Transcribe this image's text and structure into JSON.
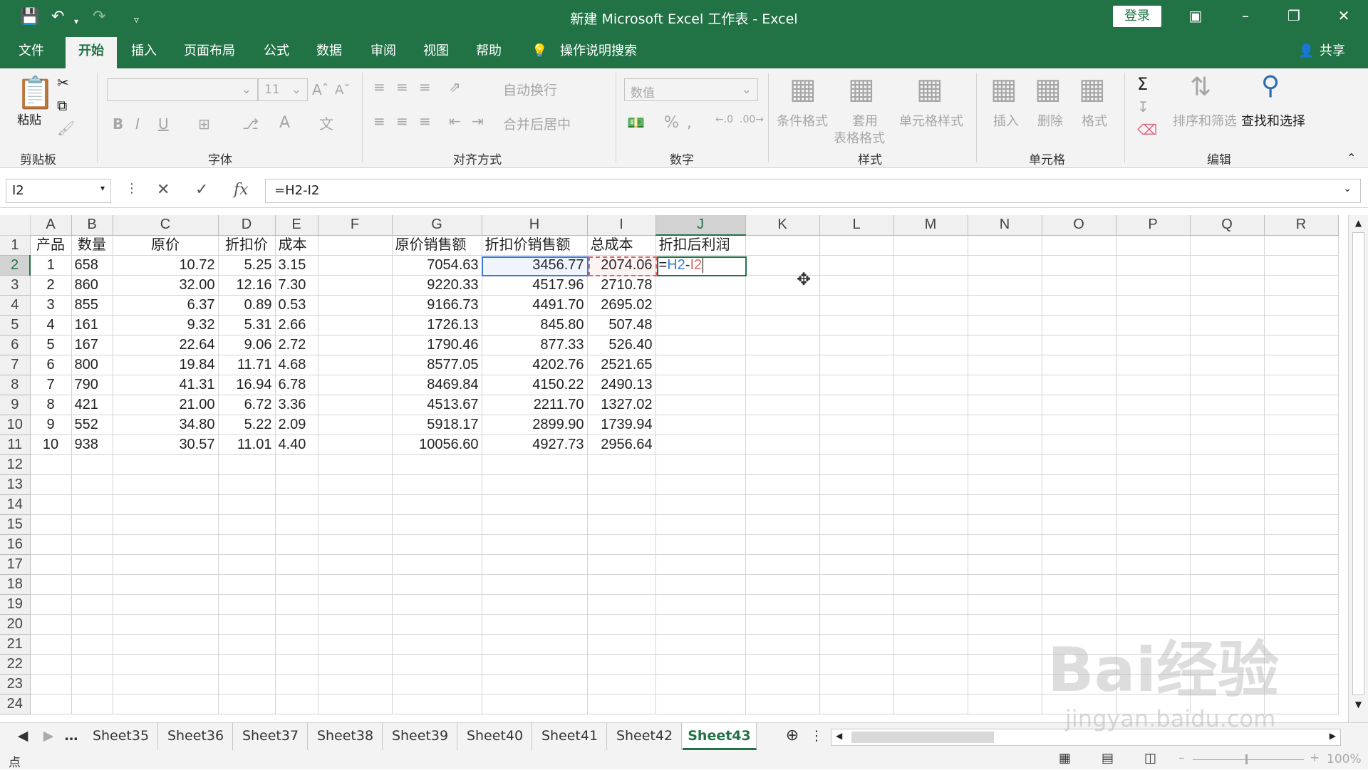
{
  "window": {
    "title": "新建 Microsoft Excel 工作表  -  Excel",
    "login": "登录"
  },
  "tabs": [
    "文件",
    "开始",
    "插入",
    "页面布局",
    "公式",
    "数据",
    "审阅",
    "视图",
    "帮助"
  ],
  "tell_me": "操作说明搜索",
  "share": "共享",
  "ribbon": {
    "clipboard": {
      "paste": "粘贴",
      "label": "剪贴板"
    },
    "font": {
      "label": "字体",
      "size": "11"
    },
    "alignment": {
      "wrap": "自动换行",
      "merge": "合并后居中",
      "label": "对齐方式"
    },
    "number": {
      "format": "数值",
      "label": "数字"
    },
    "styles": {
      "cond": "条件格式",
      "table1": "套用",
      "table2": "表格格式",
      "cell": "单元格样式",
      "label": "样式"
    },
    "cells": {
      "insert": "插入",
      "delete": "删除",
      "format": "格式",
      "label": "单元格"
    },
    "editing": {
      "sort": "排序和筛选",
      "find": "查找和选择",
      "label": "编辑"
    }
  },
  "formula_bar": {
    "name_box": "I2",
    "formula": "=H2-I2"
  },
  "columns": [
    "A",
    "B",
    "C",
    "D",
    "E",
    "F",
    "G",
    "H",
    "I",
    "J",
    "K",
    "L",
    "M",
    "N",
    "O",
    "P",
    "Q",
    "R"
  ],
  "headers": [
    "产品",
    "数量",
    "原价",
    "折扣价",
    "成本",
    "",
    "原价销售额",
    "折扣价销售额",
    "总成本",
    "折扣后利润"
  ],
  "rows": [
    [
      "1",
      "658",
      "10.72",
      "5.25",
      "3.15",
      "",
      "7054.63",
      "3456.77",
      "2074.06"
    ],
    [
      "2",
      "860",
      "32.00",
      "12.16",
      "7.30",
      "",
      "9220.33",
      "4517.96",
      "2710.78"
    ],
    [
      "3",
      "855",
      "6.37",
      "0.89",
      "0.53",
      "",
      "9166.73",
      "4491.70",
      "2695.02"
    ],
    [
      "4",
      "161",
      "9.32",
      "5.31",
      "2.66",
      "",
      "1726.13",
      "845.80",
      "507.48"
    ],
    [
      "5",
      "167",
      "22.64",
      "9.06",
      "2.72",
      "",
      "1790.46",
      "877.33",
      "526.40"
    ],
    [
      "6",
      "800",
      "19.84",
      "11.71",
      "4.68",
      "",
      "8577.05",
      "4202.76",
      "2521.65"
    ],
    [
      "7",
      "790",
      "41.31",
      "16.94",
      "6.78",
      "",
      "8469.84",
      "4150.22",
      "2490.13"
    ],
    [
      "8",
      "421",
      "21.00",
      "6.72",
      "3.36",
      "",
      "4513.67",
      "2211.70",
      "1327.02"
    ],
    [
      "9",
      "552",
      "34.80",
      "5.22",
      "2.09",
      "",
      "5918.17",
      "2899.90",
      "1739.94"
    ],
    [
      "10",
      "938",
      "30.57",
      "11.01",
      "4.40",
      "",
      "10056.60",
      "4927.73",
      "2956.64"
    ]
  ],
  "editing_cell": {
    "eq": "=",
    "ref1": "H2",
    "minus": "-",
    "ref2": "I2"
  },
  "sheets": [
    "Sheet35",
    "Sheet36",
    "Sheet37",
    "Sheet38",
    "Sheet39",
    "Sheet40",
    "Sheet41",
    "Sheet42",
    "Sheet43"
  ],
  "active_sheet": "Sheet43",
  "status": {
    "mode": "点",
    "zoom": "100%"
  },
  "watermark": {
    "brand": "Bai经验",
    "url": "jingyan.baidu.com"
  },
  "colors": {
    "accent": "#217346",
    "ref_blue": "#3c78d8",
    "ref_red": "#e06666"
  }
}
